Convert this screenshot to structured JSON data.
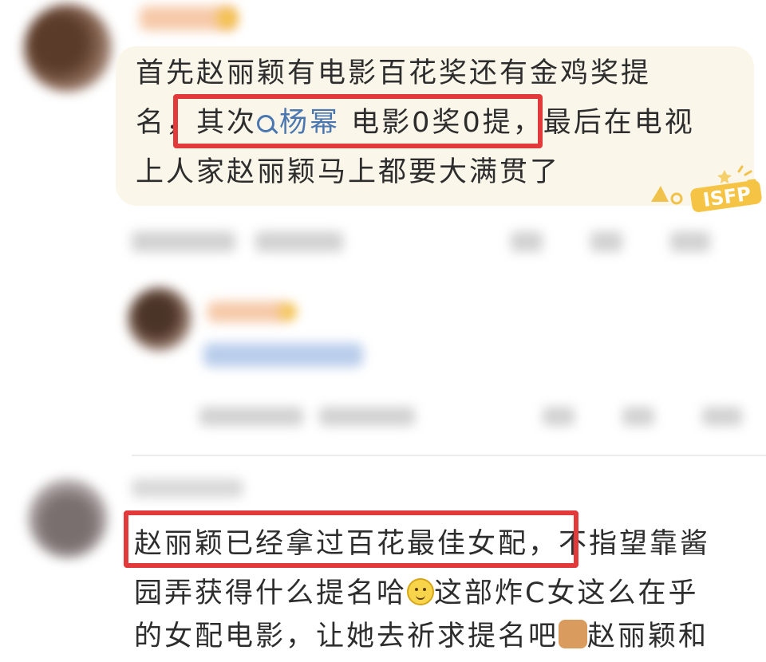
{
  "comment1": {
    "line1": "首先赵丽颖有电影百花奖还有金鸡奖提",
    "line2_pre": "名，",
    "line2_boxed_pre": "其次",
    "line2_mention": "杨幂",
    "line2_boxed_post": " 电影0奖0提，",
    "line2_post": "最后在电视",
    "line3": "上人家赵丽颖马上都要大满贯了"
  },
  "badge": {
    "text": "ISFP"
  },
  "comment2": {
    "boxed": "赵丽颖已经拿过百花最佳女配，",
    "line1_post": "不指望靠酱",
    "line2_pre": "园弄获得什么提名哈",
    "line2_post": "这部炸C女这么在乎",
    "line3_pre": "的女配电影，让她去祈求提名吧",
    "line3_post": "赵丽颖和"
  },
  "icons": {
    "mention": "search-icon",
    "smile": "smile-emoji-icon",
    "cat": "cat-emoji-icon"
  },
  "colors": {
    "highlight": "#e23a3a",
    "mention": "#4a77b0",
    "bubble": "#fbf6ea"
  }
}
